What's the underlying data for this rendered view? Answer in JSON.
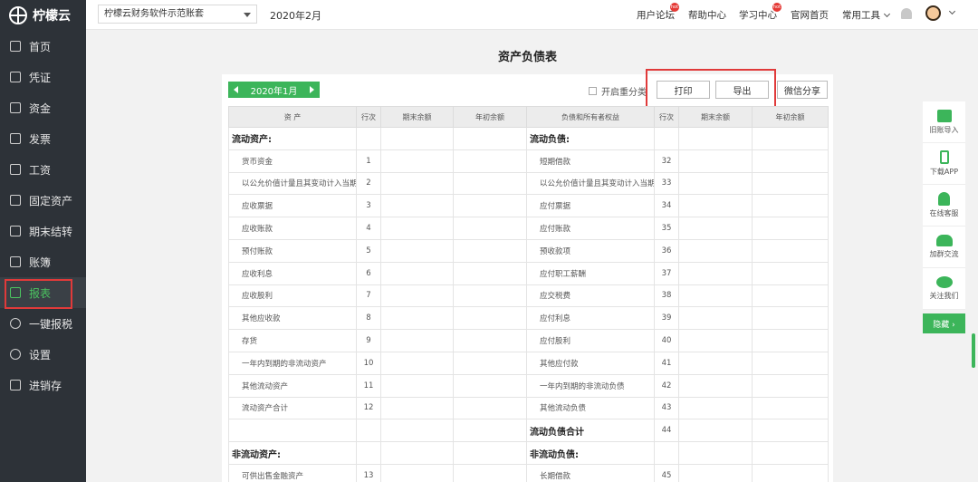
{
  "app": {
    "logo_text": "柠檬云"
  },
  "sidebar": {
    "items": [
      {
        "label": "首页",
        "icon": "home-icon"
      },
      {
        "label": "凭证",
        "icon": "voucher-icon"
      },
      {
        "label": "资金",
        "icon": "fund-icon"
      },
      {
        "label": "发票",
        "icon": "invoice-icon"
      },
      {
        "label": "工资",
        "icon": "salary-icon"
      },
      {
        "label": "固定资产",
        "icon": "fixed-asset-icon"
      },
      {
        "label": "期末结转",
        "icon": "period-close-icon"
      },
      {
        "label": "账簿",
        "icon": "ledger-icon"
      },
      {
        "label": "报表",
        "icon": "report-icon",
        "active": true
      },
      {
        "label": "一键报税",
        "icon": "tax-icon"
      },
      {
        "label": "设置",
        "icon": "settings-icon"
      },
      {
        "label": "进销存",
        "icon": "inventory-icon"
      }
    ]
  },
  "topbar": {
    "account_select": "柠檬云财务软件示范账套",
    "period": "2020年2月",
    "links": {
      "forum": "用户论坛",
      "help": "帮助中心",
      "learn": "学习中心",
      "home": "官网首页",
      "tools": "常用工具"
    },
    "hot_badge": "hot"
  },
  "report": {
    "title": "资产负债表",
    "period_nav": "2020年1月",
    "reclassify_label": "开启重分类",
    "print_label": "打印",
    "export_label": "导出",
    "wechat_share_label": "微信分享",
    "headers": [
      "资 产",
      "行次",
      "期末余额",
      "年初余额",
      "负债和所有者权益",
      "行次",
      "期末余额",
      "年初余额"
    ],
    "rows": [
      {
        "a": "流动资产:",
        "an": "",
        "l": "流动负债:",
        "ln": "",
        "a_sec": true,
        "l_sec": true
      },
      {
        "a": "货币资金",
        "an": "1",
        "l": "短期借款",
        "ln": "32"
      },
      {
        "a": "以公允价值计量且其变动计入当期",
        "an": "2",
        "l": "以公允价值计量且其变动计入当期",
        "ln": "33"
      },
      {
        "a": "应收票据",
        "an": "3",
        "l": "应付票据",
        "ln": "34"
      },
      {
        "a": "应收账款",
        "an": "4",
        "l": "应付账款",
        "ln": "35"
      },
      {
        "a": "预付账款",
        "an": "5",
        "l": "预收款项",
        "ln": "36"
      },
      {
        "a": "应收利息",
        "an": "6",
        "l": "应付职工薪酬",
        "ln": "37"
      },
      {
        "a": "应收股利",
        "an": "7",
        "l": "应交税费",
        "ln": "38"
      },
      {
        "a": "其他应收款",
        "an": "8",
        "l": "应付利息",
        "ln": "39"
      },
      {
        "a": "存货",
        "an": "9",
        "l": "应付股利",
        "ln": "40"
      },
      {
        "a": "一年内到期的非流动资产",
        "an": "10",
        "l": "其他应付款",
        "ln": "41"
      },
      {
        "a": "其他流动资产",
        "an": "11",
        "l": "一年内到期的非流动负债",
        "ln": "42"
      },
      {
        "a": "流动资产合计",
        "an": "12",
        "l": "其他流动负债",
        "ln": "43"
      },
      {
        "a": "",
        "an": "",
        "l": "流动负债合计",
        "ln": "44",
        "l_sec": true
      },
      {
        "a": "非流动资产:",
        "an": "",
        "l": "非流动负债:",
        "ln": "",
        "a_sec": true,
        "l_sec": true
      },
      {
        "a": "可供出售金融资产",
        "an": "13",
        "l": "长期借款",
        "ln": "45"
      }
    ]
  },
  "right_tools": {
    "items": [
      {
        "label": "旧账导入",
        "icon": "import-icon"
      },
      {
        "label": "下载APP",
        "icon": "phone-icon"
      },
      {
        "label": "在线客服",
        "icon": "customer-service-icon"
      },
      {
        "label": "加群交流",
        "icon": "group-icon"
      },
      {
        "label": "关注我们",
        "icon": "wechat-icon"
      }
    ],
    "hide_label": "隐藏 ›"
  },
  "colors": {
    "brand_green": "#3cb55a",
    "sidebar_bg": "#2d3238",
    "highlight_red": "#e03a3a"
  }
}
